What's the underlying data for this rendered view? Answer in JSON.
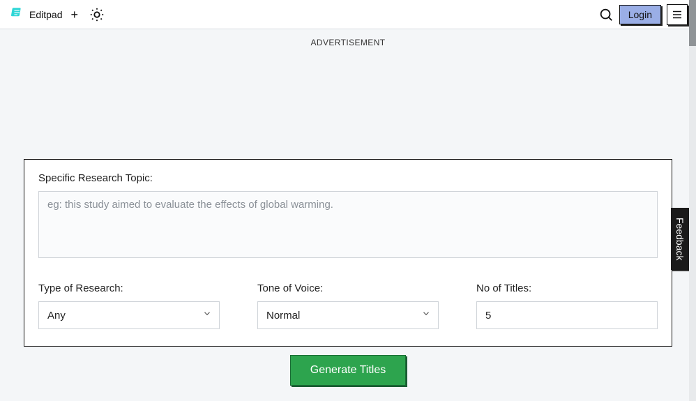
{
  "header": {
    "brand": "Editpad",
    "login_label": "Login"
  },
  "ad_label": "ADVERTISEMENT",
  "form": {
    "topic_label": "Specific Research Topic:",
    "topic_placeholder": "eg: this study aimed to evaluate the effects of global warming.",
    "type_label": "Type of Research:",
    "type_value": "Any",
    "tone_label": "Tone of Voice:",
    "tone_value": "Normal",
    "count_label": "No of Titles:",
    "count_value": "5",
    "generate_label": "Generate Titles"
  },
  "feedback_label": "Feedback"
}
